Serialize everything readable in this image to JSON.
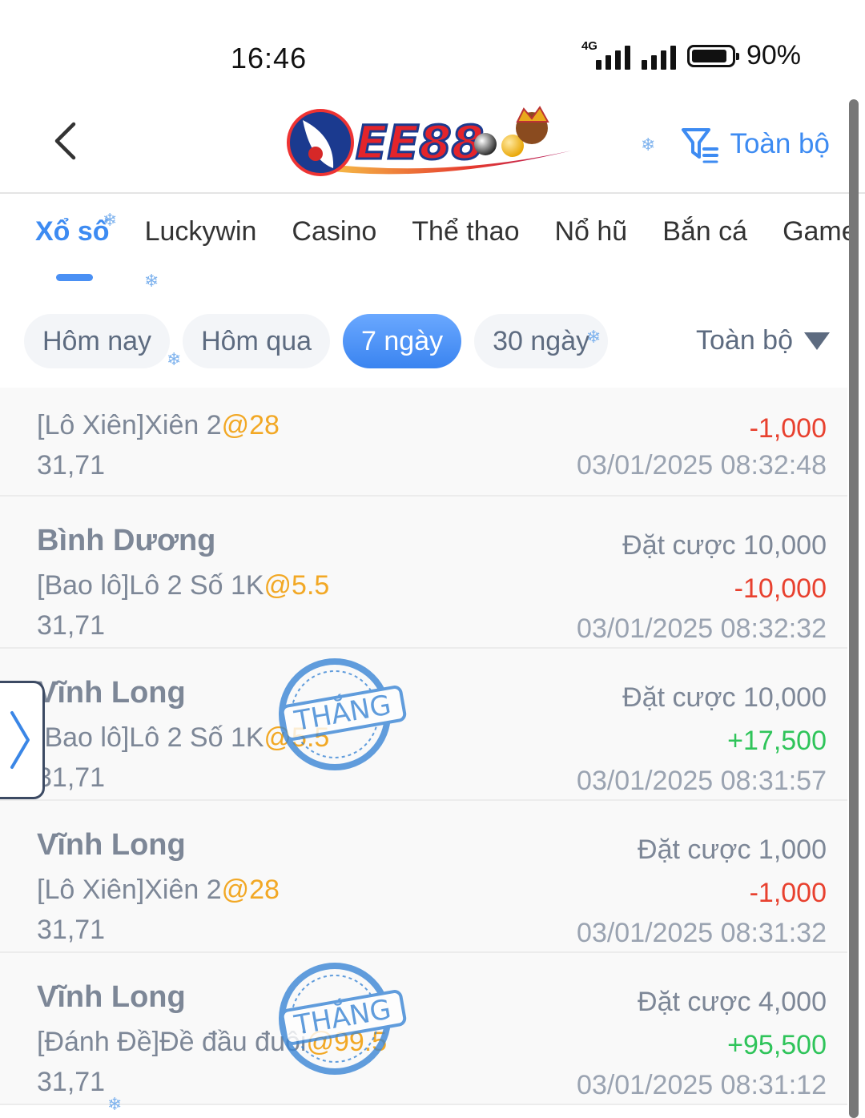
{
  "status_bar": {
    "time": "16:46",
    "network": "4G",
    "battery_level": 0.9,
    "battery_text": "90%"
  },
  "header": {
    "logo_text": "EE88",
    "filter_label": "Toàn bộ"
  },
  "category_tabs": [
    "Xổ số",
    "Luckywin",
    "Casino",
    "Thể thao",
    "Nổ hũ",
    "Bắn cá",
    "Game"
  ],
  "active_category": "Xổ số",
  "date_pills": [
    "Hôm nay",
    "Hôm qua",
    "7 ngày",
    "30 ngày"
  ],
  "active_date_pill": "7 ngày",
  "scope_select": "Toàn bộ",
  "stamp_text": "THẮNG",
  "colors": {
    "accent": "#3d8bf2",
    "odds": "#f2a825",
    "loss": "#e8412f",
    "win": "#2fc45a",
    "muted": "#7d8797"
  },
  "records": [
    {
      "title": "",
      "bet_type": "[Lô Xiên]Xiên 2",
      "odds": "@28",
      "numbers": "31,71",
      "stake": "",
      "amount": "-1,000",
      "time": "03/01/2025 08:32:48"
    },
    {
      "title": "Bình Dương",
      "bet_type": "[Bao lô]Lô 2 Số 1K",
      "odds": "@5.5",
      "numbers": "31,71",
      "stake": "Đặt cược 10,000",
      "amount": "-10,000",
      "time": "03/01/2025 08:32:32"
    },
    {
      "title": "Vĩnh Long",
      "bet_type": "[Bao lô]Lô 2 Số 1K",
      "odds": "@5.5",
      "numbers": "31,71",
      "stake": "Đặt cược 10,000",
      "amount": "+17,500",
      "time": "03/01/2025 08:31:57"
    },
    {
      "title": "Vĩnh Long",
      "bet_type": "[Lô Xiên]Xiên 2",
      "odds": "@28",
      "numbers": "31,71",
      "stake": "Đặt cược 1,000",
      "amount": "-1,000",
      "time": "03/01/2025 08:31:32"
    },
    {
      "title": "Vĩnh Long",
      "bet_type": "[Đánh Đề]Đề đầu đuôi",
      "odds": "@99.5",
      "numbers": "31,71",
      "stake": "Đặt cược 4,000",
      "amount": "+95,500",
      "time": "03/01/2025 08:31:12"
    }
  ]
}
